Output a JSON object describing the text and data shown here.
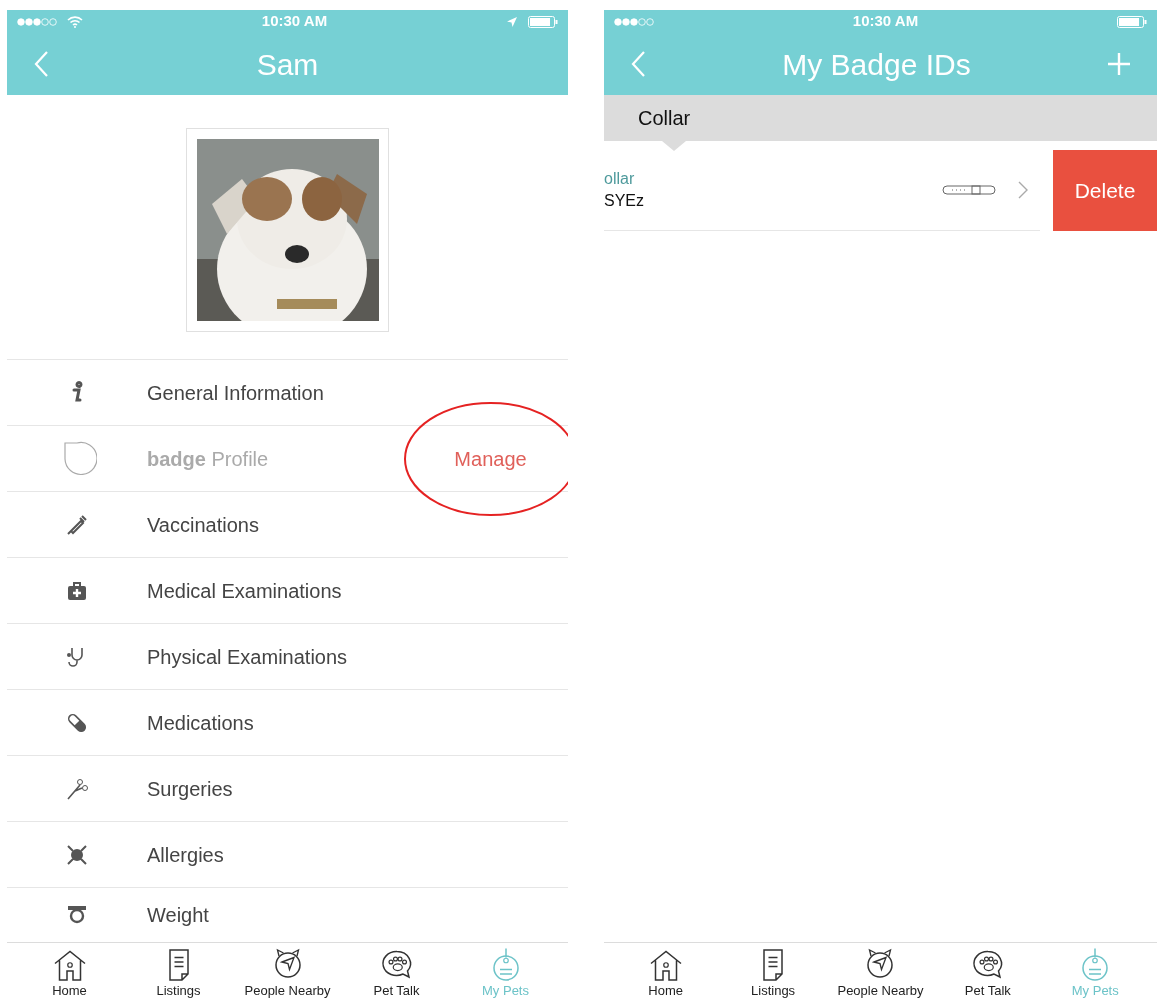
{
  "profile_screen": {
    "status_bar": {
      "time": "10:30 AM"
    },
    "nav_bar": {
      "title": "Sam"
    },
    "menu": [
      {
        "label": "General Information",
        "disabled": false
      },
      {
        "label": "**badge** Profile",
        "disabled": true,
        "action": "Manage",
        "circled": true
      },
      {
        "label": "Vaccinations",
        "disabled": false
      },
      {
        "label": "Medical Examinations",
        "disabled": false
      },
      {
        "label": "Physical Examinations",
        "disabled": false
      },
      {
        "label": "Medications",
        "disabled": false
      },
      {
        "label": "Surgeries",
        "disabled": false
      },
      {
        "label": "Allergies",
        "disabled": false
      },
      {
        "label": "Weight",
        "disabled": false
      }
    ],
    "tab_bar": [
      {
        "label": "Home",
        "selected": false
      },
      {
        "label": "Listings",
        "selected": false
      },
      {
        "label": "People Nearby",
        "selected": false
      },
      {
        "label": "Pet Talk",
        "selected": false
      },
      {
        "label": "My Pets",
        "selected": true
      }
    ]
  },
  "badges_screen": {
    "status_bar": {
      "time": "10:30 AM"
    },
    "nav_bar": {
      "title": "My Badge IDs"
    },
    "section": "Collar",
    "rows": [
      {
        "title": "ollar",
        "code": "SYEz",
        "action": "Delete"
      }
    ],
    "tab_bar": [
      {
        "label": "Home",
        "selected": false
      },
      {
        "label": "Listings",
        "selected": false
      },
      {
        "label": "People Nearby",
        "selected": false
      },
      {
        "label": "Pet Talk",
        "selected": false
      },
      {
        "label": "My Pets",
        "selected": true
      }
    ]
  }
}
